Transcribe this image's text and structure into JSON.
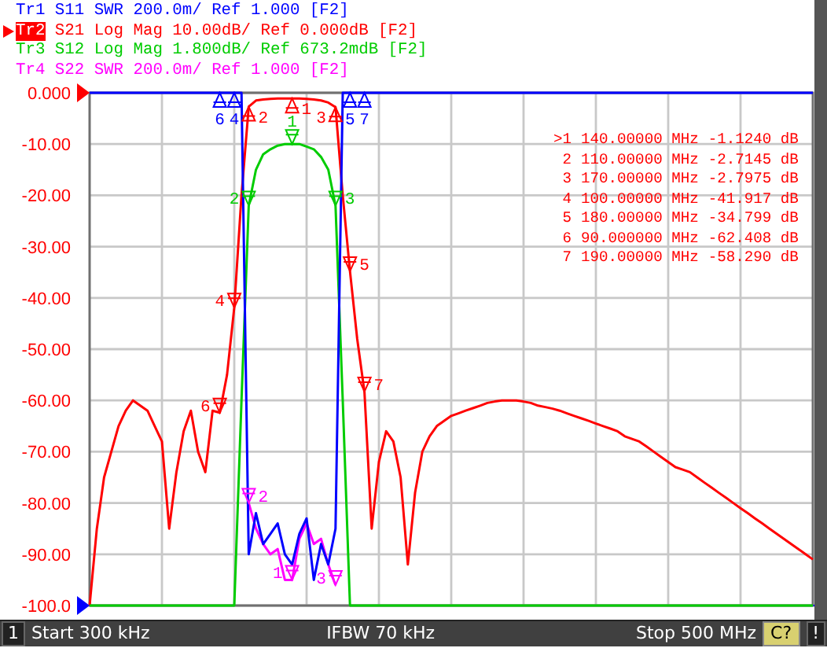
{
  "traces": [
    {
      "label": "Tr1",
      "parameter": "S11",
      "format": "SWR",
      "scale": "200.0m/",
      "reference": "Ref 1.000",
      "softkey": "[F2]",
      "color": "#0000ff",
      "selected": false,
      "markers": [
        "6",
        "4",
        "5",
        "7"
      ]
    },
    {
      "label": "Tr2",
      "parameter": "S21",
      "format": "Log Mag",
      "scale": "10.00dB/",
      "reference": "Ref 0.000dB",
      "softkey": "[F2]",
      "color": "#ff0000",
      "selected": true,
      "markers": [
        "1",
        "2",
        "3",
        "4",
        "5",
        "6",
        "7"
      ]
    },
    {
      "label": "Tr3",
      "parameter": "S12",
      "format": "Log Mag",
      "scale": "1.800dB/",
      "reference": "Ref 673.2mdB",
      "softkey": "[F2]",
      "color": "#00cc00",
      "selected": false,
      "markers": [
        "1",
        "2",
        "3"
      ]
    },
    {
      "label": "Tr4",
      "parameter": "S22",
      "format": "SWR",
      "scale": "200.0m/",
      "reference": "Ref 1.000",
      "softkey": "[F2]",
      "color": "#ff00ff",
      "selected": false,
      "markers": [
        "2",
        "1",
        "3"
      ]
    }
  ],
  "chart": {
    "chart_data": {
      "type": "line",
      "grid": true,
      "ylim": [
        -100,
        0
      ],
      "yticks": [
        {
          "value": 0,
          "label": "0.000"
        },
        {
          "value": -10,
          "label": "-10.00"
        },
        {
          "value": -20,
          "label": "-20.00"
        },
        {
          "value": -30,
          "label": "-30.00"
        },
        {
          "value": -40,
          "label": "-40.00"
        },
        {
          "value": -50,
          "label": "-50.00"
        },
        {
          "value": -60,
          "label": "-60.00"
        },
        {
          "value": -70,
          "label": "-70.00"
        },
        {
          "value": -80,
          "label": "-80.00"
        },
        {
          "value": -90,
          "label": "-90.00"
        },
        {
          "value": -100,
          "label": "-100.0"
        }
      ],
      "categories": [
        null,
        null,
        null,
        null,
        null,
        null,
        null,
        null,
        null,
        null,
        null,
        null,
        null,
        null,
        null,
        null,
        null,
        null,
        null,
        null,
        null,
        null,
        null,
        null,
        null,
        null,
        null,
        null,
        null,
        null,
        null,
        null,
        null,
        null,
        null,
        null,
        null,
        null,
        null,
        null,
        null,
        null,
        null,
        null,
        null,
        null,
        null,
        null,
        null,
        null,
        null,
        null,
        null,
        null,
        null,
        null,
        null,
        null,
        null,
        null,
        null,
        null,
        null,
        null,
        null,
        null,
        null,
        null,
        null,
        null,
        null,
        null,
        null,
        null,
        null,
        null,
        null,
        null,
        null,
        null,
        null,
        null,
        null,
        null,
        null,
        null,
        null,
        null,
        null,
        null,
        null,
        null,
        null,
        null,
        null,
        null,
        null,
        null,
        null,
        null,
        null
      ],
      "series": [
        {
          "color": "#0000ff",
          "values": [
            0,
            0,
            0,
            0,
            0,
            0,
            0,
            0,
            0,
            0,
            0,
            0,
            0,
            0,
            0,
            0,
            0,
            0,
            0,
            0,
            0,
            0,
            -90,
            -82,
            -88,
            -86,
            -84,
            -90,
            -92,
            -86,
            -83,
            -95,
            -88,
            -92,
            -85,
            0,
            0,
            0,
            0,
            0,
            0,
            0,
            0,
            0,
            0,
            0,
            0,
            0,
            0,
            0,
            0,
            0,
            0,
            0,
            0,
            0,
            0,
            0,
            0,
            0,
            0,
            0,
            0,
            0,
            0,
            0,
            0,
            0,
            0,
            0,
            0,
            0,
            0,
            0,
            0,
            0,
            0,
            0,
            0,
            0,
            0,
            0,
            0,
            0,
            0,
            0,
            0,
            0,
            0,
            0,
            0,
            0,
            0,
            0,
            0,
            0,
            0,
            0,
            0,
            0,
            0
          ]
        },
        {
          "color": "#ff0000",
          "values": [
            -100,
            -85,
            -75,
            -70,
            -65,
            -62,
            -60,
            -61,
            -62,
            -65,
            -68,
            -85,
            -74,
            -66,
            -62,
            -70,
            -74,
            -62,
            -62.4,
            -55,
            -41.9,
            -20,
            -2.7,
            -1.5,
            -1.3,
            -1.2,
            -1.1,
            -1.1,
            -1.1,
            -1.1,
            -1.2,
            -1.3,
            -1.5,
            -1.9,
            -2.8,
            -20,
            -34.8,
            -48,
            -58.3,
            -85,
            -72,
            -66,
            -68,
            -75,
            -92,
            -78,
            -70,
            -67,
            -65,
            -64,
            -63,
            -62.5,
            -62,
            -61.5,
            -61,
            -60.5,
            -60.2,
            -60,
            -60,
            -60,
            -60.2,
            -60.5,
            -61,
            -61.3,
            -61.6,
            -62,
            -62.5,
            -63,
            -63.5,
            -64,
            -64.5,
            -65,
            -65.5,
            -66,
            -67,
            -67.5,
            -68,
            -69,
            -70,
            -71,
            -72,
            -73,
            -73.5,
            -74,
            -75,
            -76,
            -77,
            -78,
            -79,
            -80,
            -81,
            -82,
            -83,
            -84,
            -85,
            -86,
            -87,
            -88,
            -89,
            -90,
            -91
          ]
        },
        {
          "color": "#00cc00",
          "values": [
            -100,
            -100,
            -100,
            -100,
            -100,
            -100,
            -100,
            -100,
            -100,
            -100,
            -100,
            -100,
            -100,
            -100,
            -100,
            -100,
            -100,
            -100,
            -100,
            -100,
            -100,
            -60,
            -22,
            -15,
            -12,
            -11,
            -10.3,
            -10,
            -10,
            -10,
            -10.5,
            -11,
            -12.5,
            -15,
            -22,
            -60,
            -100,
            -100,
            -100,
            -100,
            -100,
            -100,
            -100,
            -100,
            -100,
            -100,
            -100,
            -100,
            -100,
            -100,
            -100,
            -100,
            -100,
            -100,
            -100,
            -100,
            -100,
            -100,
            -100,
            -100,
            -100,
            -100,
            -100,
            -100,
            -100,
            -100,
            -100,
            -100,
            -100,
            -100,
            -100,
            -100,
            -100,
            -100,
            -100,
            -100,
            -100,
            -100,
            -100,
            -100,
            -100,
            -100,
            -100,
            -100,
            -100,
            -100,
            -100,
            -100,
            -100,
            -100,
            -100,
            -100,
            -100,
            -100,
            -100,
            -100,
            -100,
            -100,
            -100,
            -100,
            -100
          ]
        },
        {
          "color": "#ff00ff",
          "values": [
            null,
            null,
            null,
            null,
            null,
            null,
            null,
            null,
            null,
            null,
            null,
            null,
            null,
            null,
            null,
            null,
            null,
            null,
            null,
            null,
            null,
            null,
            -80,
            -85,
            -88,
            -90,
            -89,
            -95,
            -95,
            -87,
            -84,
            -88,
            -87,
            -92,
            -96,
            null,
            null,
            null,
            null,
            null,
            null,
            null,
            null,
            null,
            null,
            null,
            null,
            null,
            null,
            null,
            null,
            null,
            null,
            null,
            null,
            null,
            null,
            null,
            null,
            null,
            null,
            null,
            null,
            null,
            null,
            null,
            null,
            null,
            null,
            null,
            null,
            null,
            null,
            null,
            null,
            null,
            null,
            null,
            null,
            null,
            null,
            null,
            null,
            null,
            null,
            null,
            null,
            null,
            null,
            null,
            null,
            null,
            null,
            null,
            null,
            null,
            null,
            null,
            null,
            null,
            null
          ]
        }
      ]
    },
    "marker_table": [
      {
        "marker": ">1",
        "frequency": "140.00000 MHz",
        "value": "-1.1240 dB"
      },
      {
        "marker": "2",
        "frequency": "110.00000 MHz",
        "value": "-2.7145 dB"
      },
      {
        "marker": "3",
        "frequency": "170.00000 MHz",
        "value": "-2.7975 dB"
      },
      {
        "marker": "4",
        "frequency": "100.00000 MHz",
        "value": "-41.917 dB"
      },
      {
        "marker": "5",
        "frequency": "180.00000 MHz",
        "value": "-34.799 dB"
      },
      {
        "marker": "6",
        "frequency": "90.000000 MHz",
        "value": "-62.408 dB"
      },
      {
        "marker": "7",
        "frequency": "190.00000 MHz",
        "value": "-58.290 dB"
      }
    ]
  },
  "status_bar": {
    "channel": "1",
    "start": "Start 300 kHz",
    "ifbw": "IFBW 70 kHz",
    "stop": "Stop 500 MHz",
    "calibration": "C?",
    "alert": "!"
  }
}
